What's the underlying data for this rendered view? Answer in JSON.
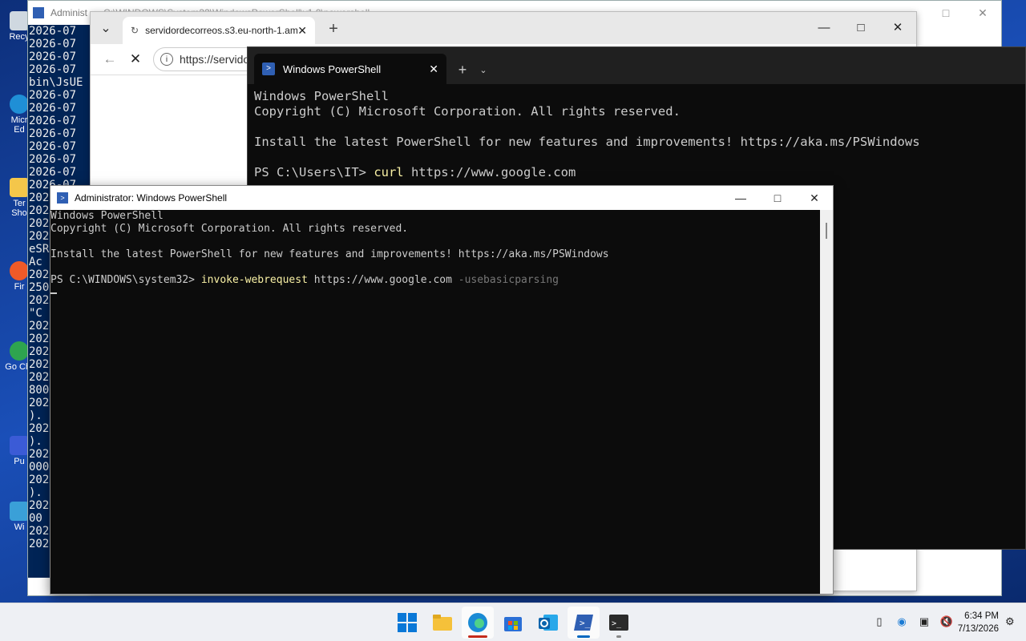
{
  "desktop": {
    "icons": [
      {
        "label": "Recy"
      },
      {
        "label": "Micr Ed"
      },
      {
        "label": "Ter Sho"
      },
      {
        "label": "Fir"
      },
      {
        "label": "Go Chr"
      },
      {
        "label": "Pu"
      },
      {
        "label": "Wi"
      }
    ]
  },
  "back_window": {
    "title": "Administ",
    "title_rest": "C:\\WINDOWS\\System32\\WindowsPowerShell\\v1.0\\powershell",
    "log_lines": [
      "2026-07",
      "2026-07",
      "2026-07",
      "2026-07",
      "bin\\JsUE",
      "2026-07",
      "2026-07",
      "2026-07",
      "2026-07",
      "2026-07",
      "2026-07",
      "2026-07",
      "2026-07",
      "202",
      "202",
      "202",
      "202",
      "eSR",
      " Ac",
      "202",
      "250",
      "202",
      " \"C",
      "202",
      "202",
      "202",
      "202",
      "202",
      "800",
      "202",
      ").",
      "202",
      "). ",
      "202",
      "000",
      "202",
      ").",
      "202",
      "00",
      "202",
      "202"
    ]
  },
  "browser": {
    "tab_label": "servidordecorreos.s3.eu-north-1.am",
    "address": "https://servido",
    "colors": {
      "accent": "#0067c0"
    }
  },
  "terminal": {
    "tab_label": "Windows PowerShell",
    "line1": "Windows PowerShell",
    "line2": "Copyright (C) Microsoft Corporation. All rights reserved.",
    "line3": "Install the latest PowerShell for new features and improvements! https://aka.ms/PSWindows",
    "prompt": "PS C:\\Users\\IT> ",
    "cmd": "curl",
    "arg": " https://www.google.com"
  },
  "console": {
    "title": "Administrator: Windows PowerShell",
    "line1": "Windows PowerShell",
    "line2": "Copyright (C) Microsoft Corporation. All rights reserved.",
    "line3": "Install the latest PowerShell for new features and improvements! https://aka.ms/PSWindows",
    "prompt": "PS C:\\WINDOWS\\system32> ",
    "cmd": "invoke-webrequest",
    "arg": " https://www.google.com ",
    "param": "-usebasicparsing"
  },
  "taskbar": {
    "apps": [
      "start-icon",
      "file-explorer-icon",
      "edge-icon",
      "store-icon",
      "outlook-icon",
      "powershell-icon",
      "terminal-icon"
    ],
    "time": "6:34 PM",
    "date": "7/13/2026"
  }
}
